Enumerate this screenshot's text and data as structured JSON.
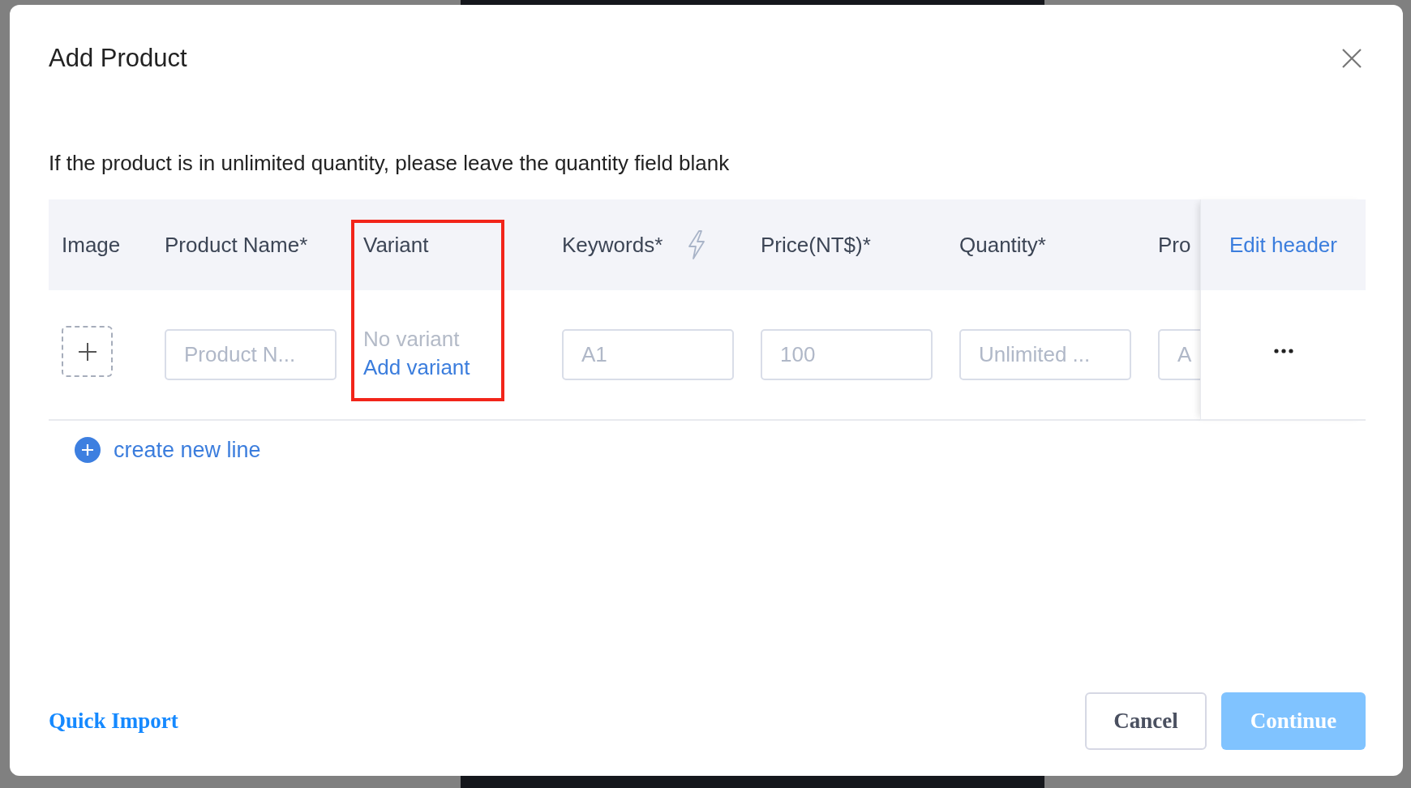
{
  "dialog": {
    "title": "Add Product"
  },
  "instruction": "If the product is in unlimited quantity, please leave the quantity field blank",
  "table": {
    "columns": [
      {
        "label": "Image",
        "kind": "image",
        "highlighted": false
      },
      {
        "label": "Product Name*",
        "kind": "text",
        "highlighted": false
      },
      {
        "label": "Variant",
        "kind": "variant",
        "highlighted": true
      },
      {
        "label": "Keywords*",
        "kind": "keywords",
        "highlighted": false
      },
      {
        "label": "Price(NT$)*",
        "kind": "text",
        "highlighted": false
      },
      {
        "label": "Quantity*",
        "kind": "text",
        "highlighted": false
      },
      {
        "label": "Pro",
        "kind": "clipped",
        "highlighted": false
      }
    ],
    "action_header": "Edit header",
    "rows": [
      {
        "cells": [
          {
            "kind": "image"
          },
          {
            "kind": "input",
            "placeholder": "Product N..."
          },
          {
            "kind": "variant",
            "status": "No variant",
            "link": "Add variant"
          },
          {
            "kind": "input",
            "placeholder": "A1"
          },
          {
            "kind": "input",
            "placeholder": "100"
          },
          {
            "kind": "input",
            "placeholder": "Unlimited ..."
          },
          {
            "kind": "input",
            "placeholder": "A"
          }
        ]
      }
    ]
  },
  "create_line": "create new line",
  "footer": {
    "link": "Quick Import",
    "buttons": [
      {
        "label": "Cancel",
        "kind": "secondary",
        "disabled": false
      },
      {
        "label": "Continue",
        "kind": "primary",
        "disabled": true
      }
    ]
  }
}
